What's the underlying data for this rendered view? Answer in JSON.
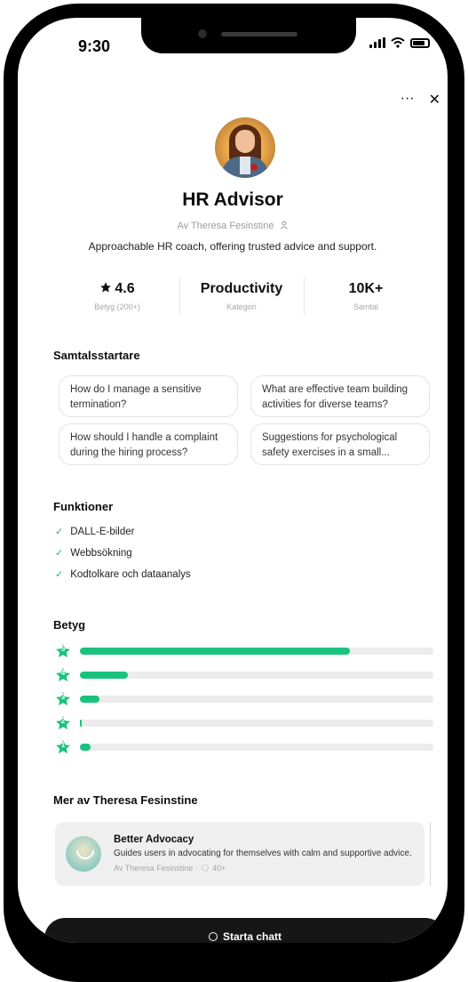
{
  "status_bar": {
    "time": "9:30"
  },
  "top_actions": {
    "more": "···",
    "close": "✕"
  },
  "gpt": {
    "title": "HR Advisor",
    "author": "Av Theresa Fesinstine",
    "description": "Approachable HR coach, offering trusted advice and support."
  },
  "stats": [
    {
      "value": "4.6",
      "label": "Betyg (200+)"
    },
    {
      "value": "Productivity",
      "label": "Kategori"
    },
    {
      "value": "10K+",
      "label": "Samtal"
    }
  ],
  "starters": {
    "heading": "Samtalsstartare",
    "items": [
      "How do I manage a sensitive termination?",
      "What are effective team building activities for diverse teams?",
      "How should I handle a complaint during the hiring process?",
      "Suggestions for psychological safety exercises in a small..."
    ]
  },
  "features": {
    "heading": "Funktioner",
    "items": [
      "DALL-E-bilder",
      "Webbsökning",
      "Kodtolkare och dataanalys"
    ]
  },
  "ratings": {
    "heading": "Betyg",
    "rows": [
      {
        "stars": "5",
        "fraction": 0.765
      },
      {
        "stars": "4",
        "fraction": 0.135
      },
      {
        "stars": "3",
        "fraction": 0.055
      },
      {
        "stars": "2",
        "fraction": 0.005
      },
      {
        "stars": "1",
        "fraction": 0.03
      }
    ],
    "accent": "#19c37d"
  },
  "more_by": {
    "heading": "Mer av Theresa Fesinstine",
    "card": {
      "title": "Better Advocacy",
      "description": "Guides users in advocating for themselves with calm and supportive advice.",
      "meta": "Av Theresa Fesinstine · 🗨 40+"
    }
  },
  "start_button": {
    "label": "Starta chatt"
  }
}
